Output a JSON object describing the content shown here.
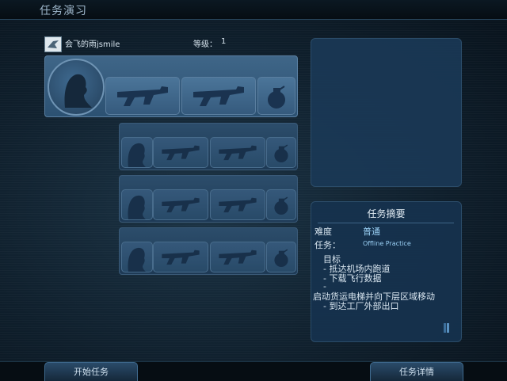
{
  "window": {
    "title": "任务演习"
  },
  "player": {
    "name": "会飞的雨jsmile",
    "level_label": "等级：",
    "level_value": "1"
  },
  "summary": {
    "title": "任务摘要",
    "difficulty_label": "难度",
    "difficulty_value": "普通",
    "mission_label": "任务：",
    "mission_value": "Offline Practice",
    "objectives_label": "目标",
    "objectives": [
      "- 抵达机场内跑道",
      "- 下载飞行数据",
      "-",
      "启动货运电梯并向下层区域移动",
      "- 到达工厂外部出口"
    ]
  },
  "buttons": {
    "start": "开始任务",
    "details": "任务详情"
  },
  "colors": {
    "panel": "#2c5172",
    "accent": "#9ad0f5",
    "background": "#0f1f2c"
  },
  "icons": {
    "slots": [
      "operator-portrait-icon",
      "rifle-icon",
      "rifle-icon",
      "grenade-icon"
    ],
    "scroll": "scroll-down-icon"
  }
}
